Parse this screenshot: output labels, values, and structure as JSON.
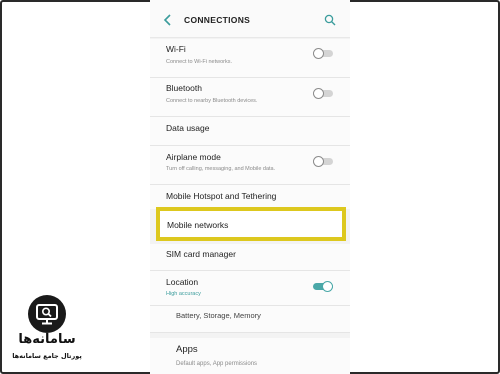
{
  "header": {
    "title": "CONNECTIONS",
    "back_icon": "chevron-left-icon",
    "search_icon": "search-icon"
  },
  "items": [
    {
      "label": "Wi-Fi",
      "sub": "Connect to Wi-Fi networks.",
      "toggle": "off"
    },
    {
      "label": "Bluetooth",
      "sub": "Connect to nearby Bluetooth devices.",
      "toggle": "off"
    },
    {
      "label": "Data usage"
    },
    {
      "label": "Airplane mode",
      "sub": "Turn off calling, messaging, and Mobile data.",
      "toggle": "off"
    },
    {
      "label": "Mobile Hotspot and Tethering"
    },
    {
      "label": "Mobile networks",
      "highlighted": true
    },
    {
      "label": "SIM card manager"
    },
    {
      "label": "Location",
      "sub": "High accuracy",
      "toggle": "on"
    },
    {
      "label": "Battery, Storage, Memory"
    },
    {
      "label": "Apps",
      "sub": "Default apps, App permissions"
    }
  ],
  "colors": {
    "highlight_border": "#ddc81e",
    "toggle_on": "#4aa8a8",
    "accent_text": "#3a9c9c"
  },
  "watermark": {
    "name": "سامانه‌ها",
    "tagline": "پورتال جامع سامانه‌ها",
    "icon": "monitor-search-icon"
  }
}
